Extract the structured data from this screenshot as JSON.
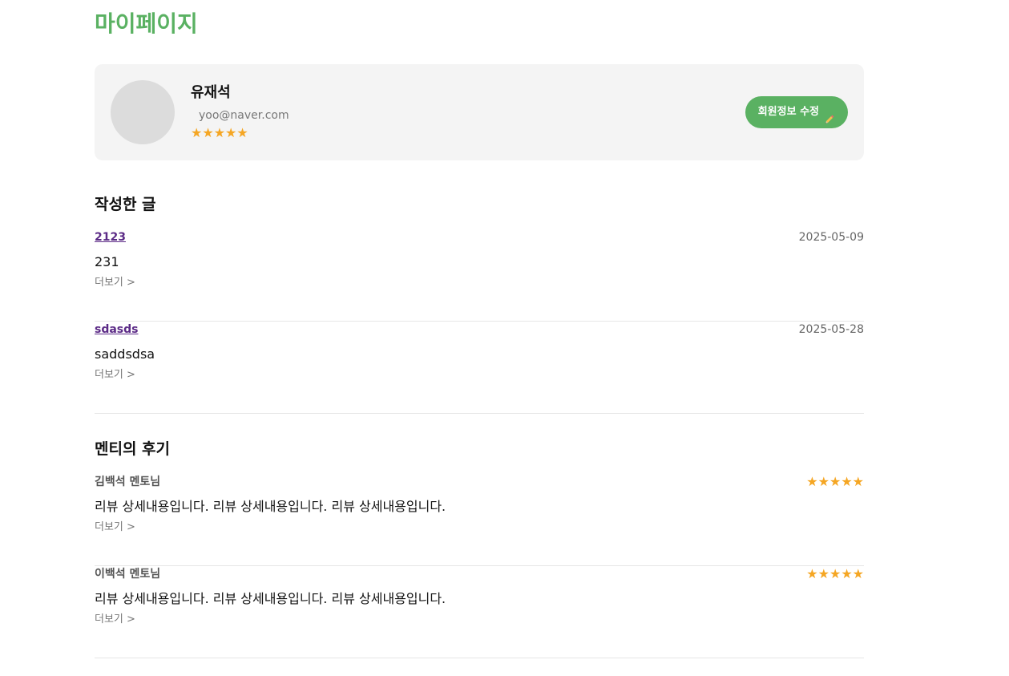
{
  "page": {
    "title": "마이페이지"
  },
  "profile": {
    "name": "유재석",
    "email": "yoo@naver.com",
    "rating": "★★★★★",
    "edit_label": "회원정보 수정"
  },
  "icons": {
    "pencil": "pencil-icon",
    "star": "star-icon"
  },
  "colors": {
    "accent": "#5ab162",
    "star": "#f5a623",
    "link": "#5b2a86"
  },
  "posts": {
    "section_title": "작성한 글",
    "items": [
      {
        "title": "2123",
        "date": "2025-05-09",
        "body": "231",
        "more": "더보기 >"
      },
      {
        "title": "sdasds",
        "date": "2025-05-28",
        "body": "saddsdsa",
        "more": "더보기 >"
      }
    ]
  },
  "reviews": {
    "section_title": "멘티의 후기",
    "items": [
      {
        "author": "김백석 멘토님",
        "rating": "★★★★★",
        "body": "리뷰 상세내용입니다. 리뷰 상세내용입니다. 리뷰 상세내용입니다.",
        "more": "더보기 >"
      },
      {
        "author": "이백석 멘토님",
        "rating": "★★★★★",
        "body": "리뷰 상세내용입니다. 리뷰 상세내용입니다. 리뷰 상세내용입니다.",
        "more": "더보기 >"
      }
    ]
  }
}
